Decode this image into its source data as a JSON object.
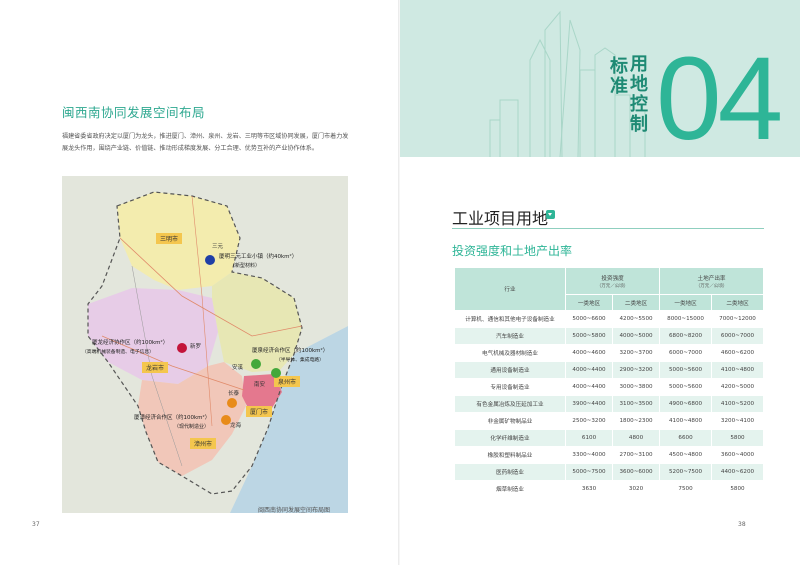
{
  "left_page": {
    "section_title": "闽西南协同发展空间布局",
    "intro": "福建省委省政府决定以厦门为龙头，推进厦门、漳州、泉州、龙岩、三明等市区域协同发展，厦门市着力发展龙头作用，围绕产业链、价值链、推动形成梯度发展、分工合理、优势互补的产业协作体系。",
    "map": {
      "cities": [
        "三明市",
        "龙岩市",
        "漳州市",
        "厦门市",
        "泉州市"
      ],
      "towns": [
        "三元",
        "新罗",
        "安溪",
        "南安",
        "长泰",
        "龙海"
      ],
      "zones": [
        {
          "label": "厦明三元工业小镇（约40km²）",
          "sub": "（新型材料）",
          "color": "#1f3fa6"
        },
        {
          "label": "厦龙经济协作区（约100km²）",
          "sub": "（高端机械装备制造、电子信息）",
          "color": "#c3143a"
        },
        {
          "label": "厦泉经济合作区（约100km²）",
          "sub": "（半导体、集成电路）",
          "color": "#43a83a"
        },
        {
          "label": "厦漳经济合作区（约100km²）",
          "sub": "（现代制造业）",
          "color": "#e88b1a"
        }
      ]
    },
    "map_caption": "闽西南协同发展空间布局图",
    "page_number": "37"
  },
  "right_page": {
    "header_vertical_1": "用地控制",
    "header_vertical_2": "标准",
    "chapter_number": "04",
    "title": "工业项目用地",
    "subtitle": "投资强度和土地产出率",
    "table": {
      "col_industry": "行业",
      "group1": "投资强度",
      "group1_unit": "（万元／公顷）",
      "group2": "土地产出率",
      "group2_unit": "（万元／公顷）",
      "sub_a": "一类地区",
      "sub_b": "二类地区",
      "rows": [
        {
          "industry": "计算机、通信和其他电子设备制造业",
          "a1": "5000~6600",
          "b1": "4200~5500",
          "a2": "8000~15000",
          "b2": "7000~12000"
        },
        {
          "industry": "汽车制造业",
          "a1": "5000~5800",
          "b1": "4000~5000",
          "a2": "6800~8200",
          "b2": "6000~7000"
        },
        {
          "industry": "电气机械及器材制造业",
          "a1": "4000~4600",
          "b1": "3200~3700",
          "a2": "6000~7000",
          "b2": "4600~6200"
        },
        {
          "industry": "通用设备制造业",
          "a1": "4000~4400",
          "b1": "2900~3200",
          "a2": "5000~5600",
          "b2": "4100~4800"
        },
        {
          "industry": "专用设备制造业",
          "a1": "4000~4400",
          "b1": "3000~3800",
          "a2": "5000~5600",
          "b2": "4200~5000"
        },
        {
          "industry": "有色金属冶炼及压延加工业",
          "a1": "3900~4400",
          "b1": "3100~3500",
          "a2": "4900~6800",
          "b2": "4100~5200"
        },
        {
          "industry": "非金属矿物制品业",
          "a1": "2500~3200",
          "b1": "1800~2300",
          "a2": "4100~4800",
          "b2": "3200~4100"
        },
        {
          "industry": "化学纤维制造业",
          "a1": "6100",
          "b1": "4800",
          "a2": "6600",
          "b2": "5800"
        },
        {
          "industry": "橡胶和塑料制品业",
          "a1": "3300~4000",
          "b1": "2700~3100",
          "a2": "4500~4800",
          "b2": "3600~4000"
        },
        {
          "industry": "医药制造业",
          "a1": "5000~7500",
          "b1": "3600~6000",
          "a2": "5200~7500",
          "b2": "4400~6200"
        },
        {
          "industry": "烟草制造业",
          "a1": "3630",
          "b1": "3020",
          "a2": "7500",
          "b2": "5800"
        }
      ]
    },
    "page_number": "38"
  }
}
